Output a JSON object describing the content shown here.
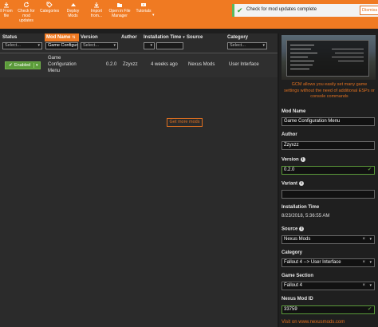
{
  "toolbar": {
    "buttons": [
      {
        "label_line1": "ll From",
        "label_line2": "file",
        "icon": "install-icon"
      },
      {
        "label_line1": "Check for",
        "label_line2": "mod updates",
        "icon": "refresh-icon"
      },
      {
        "label_line1": "Categories",
        "label_line2": "",
        "icon": "tag-icon"
      },
      {
        "label_line1": "Deploy Mods",
        "label_line2": "",
        "icon": "deploy-icon"
      },
      {
        "label_line1": "Import",
        "label_line2": "from...",
        "icon": "import-icon"
      },
      {
        "label_line1": "Open in File",
        "label_line2": "Manager",
        "icon": "folder-icon"
      },
      {
        "label_line1": "Tutorials",
        "label_line2": "",
        "icon": "video-icon"
      }
    ]
  },
  "notification": {
    "text": "Check for mod updates complete",
    "button": "Dismiss",
    "accent": "#5cb85c"
  },
  "table": {
    "columns": {
      "status": "Status",
      "mod_name": "Mod Name",
      "version": "Version",
      "author": "Author",
      "install_time": "Installation Time",
      "source": "Source",
      "category": "Category"
    },
    "filters": {
      "status": "Select...",
      "mod_name": "Game Configur",
      "version": "Select...",
      "category": "Select..."
    },
    "rows": [
      {
        "status": "Enabled",
        "name_line1": "Game",
        "name_line2": "Configuration",
        "name_line3": "Menu",
        "version": "0.2.0",
        "author": "Zzyxzz",
        "install_time": "4 weeks ago",
        "source": "Nexus Mods",
        "category": "User Interface"
      }
    ],
    "get_more": "Get more mods"
  },
  "details": {
    "description": "GCM allows you easily set many game settings without the need of additional ESPs or console commands",
    "mod_name_label": "Mod Name",
    "mod_name": "Game Configuration Menu",
    "author_label": "Author",
    "author": "Zzyxzz",
    "version_label": "Version",
    "version": "0.2.0",
    "variant_label": "Variant",
    "variant": "",
    "install_time_label": "Installation Time",
    "install_time": "8/23/2018, 5:36:55 AM",
    "source_label": "Source",
    "source": "Nexus Mods",
    "category_label": "Category",
    "category": "Fallout 4 --> User Interface",
    "game_section_label": "Game Section",
    "game_section": "Fallout 4",
    "nexus_id_label": "Nexus Mod ID",
    "nexus_id": "33759",
    "visit_link": "Visit on www.nexusmods.com"
  },
  "colors": {
    "accent_orange": "#f07a22",
    "enabled_green": "#5b9a3a",
    "background": "#2b2b2b"
  }
}
